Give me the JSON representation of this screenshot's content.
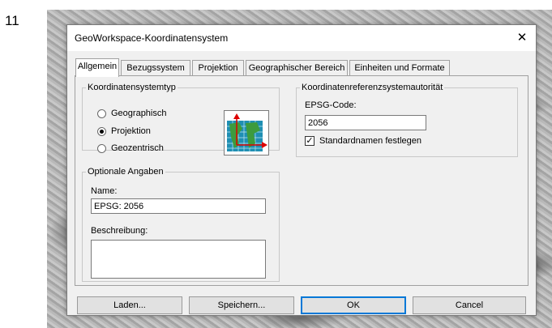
{
  "step_number": "11",
  "window": {
    "title": "GeoWorkspace-Koordinatensystem",
    "close_symbol": "✕"
  },
  "tabs": [
    {
      "label": "Allgemein",
      "active": true
    },
    {
      "label": "Bezugssystem"
    },
    {
      "label": "Projektion"
    },
    {
      "label": "Geographischer Bereich"
    },
    {
      "label": "Einheiten und Formate"
    }
  ],
  "coord_type": {
    "legend": "Koordinatensystemtyp",
    "options": [
      {
        "label": "Geographisch",
        "selected": false
      },
      {
        "label": "Projektion",
        "selected": true
      },
      {
        "label": "Geozentrisch",
        "selected": false
      }
    ],
    "icon": "projection-map-icon"
  },
  "authority": {
    "legend": "Koordinatenreferenzsystemautorität",
    "epsg_label": "EPSG-Code:",
    "epsg_value": "2056",
    "standard_names_label": "Standardnamen festlegen",
    "standard_names_checked": true
  },
  "optional": {
    "legend": "Optionale Angaben",
    "name_label": "Name:",
    "name_value": "EPSG: 2056",
    "description_label": "Beschreibung:",
    "description_value": ""
  },
  "buttons": {
    "load": "Laden...",
    "save": "Speichern...",
    "ok": "OK",
    "cancel": "Cancel"
  }
}
